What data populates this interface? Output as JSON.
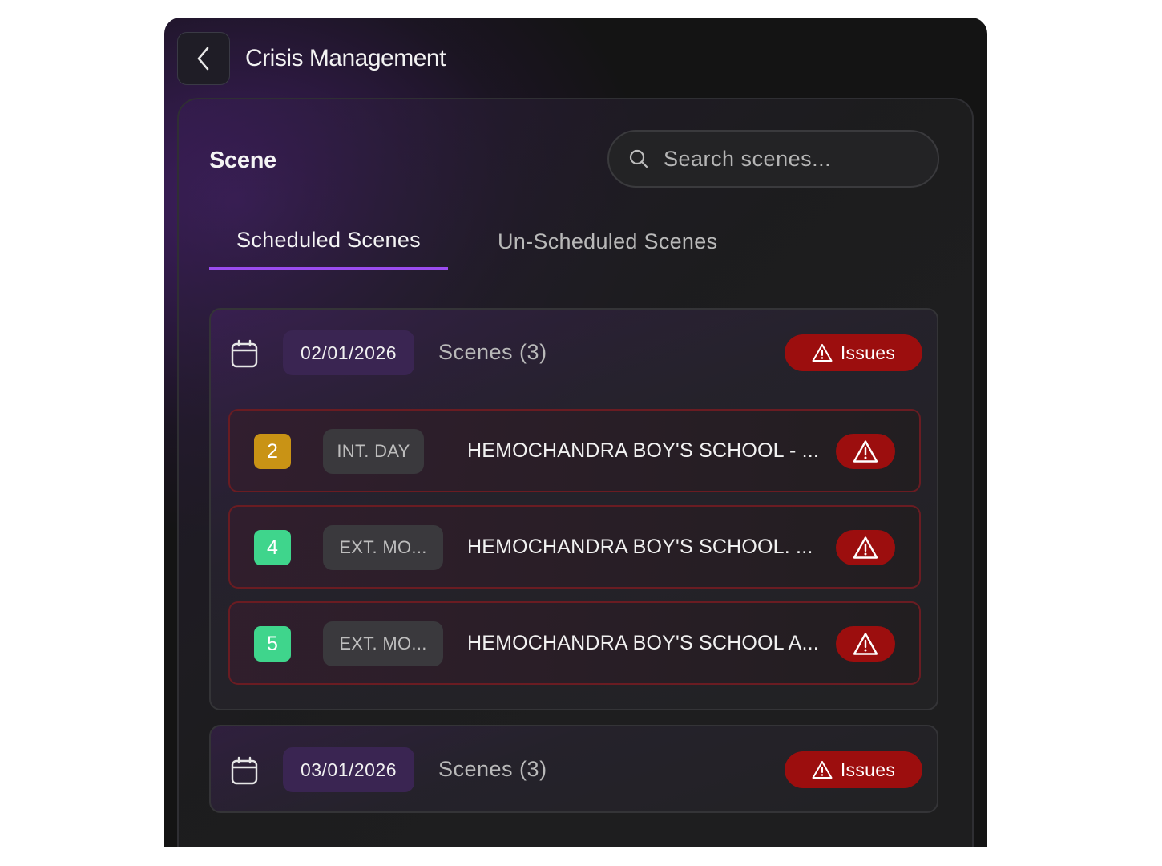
{
  "header": {
    "title": "Crisis Management"
  },
  "panel": {
    "heading": "Scene",
    "search": {
      "placeholder": "Search scenes...",
      "value": ""
    },
    "tabs": [
      {
        "label": "Scheduled Scenes",
        "active": true
      },
      {
        "label": "Un-Scheduled Scenes",
        "active": false
      }
    ]
  },
  "groups": [
    {
      "date": "02/01/2026",
      "count_label": "Scenes (3)",
      "issues_label": "Issues",
      "expanded": true,
      "scenes": [
        {
          "number": "2",
          "number_color": "#c99315",
          "type": "INT. DAY",
          "title": "HEMOCHANDRA BOY'S SCHOOL - ..."
        },
        {
          "number": "4",
          "number_color": "#3fd58c",
          "type": "EXT. MO...",
          "title": "HEMOCHANDRA BOY'S SCHOOL. ..."
        },
        {
          "number": "5",
          "number_color": "#3fd58c",
          "type": "EXT. MO...",
          "title": "HEMOCHANDRA BOY'S SCHOOL A..."
        }
      ]
    },
    {
      "date": "03/01/2026",
      "count_label": "Scenes (3)",
      "issues_label": "Issues",
      "expanded": false
    }
  ],
  "colors": {
    "accent": "#9b4cf0",
    "danger": "#9c0e0e",
    "date_chip": "#3a2552"
  }
}
